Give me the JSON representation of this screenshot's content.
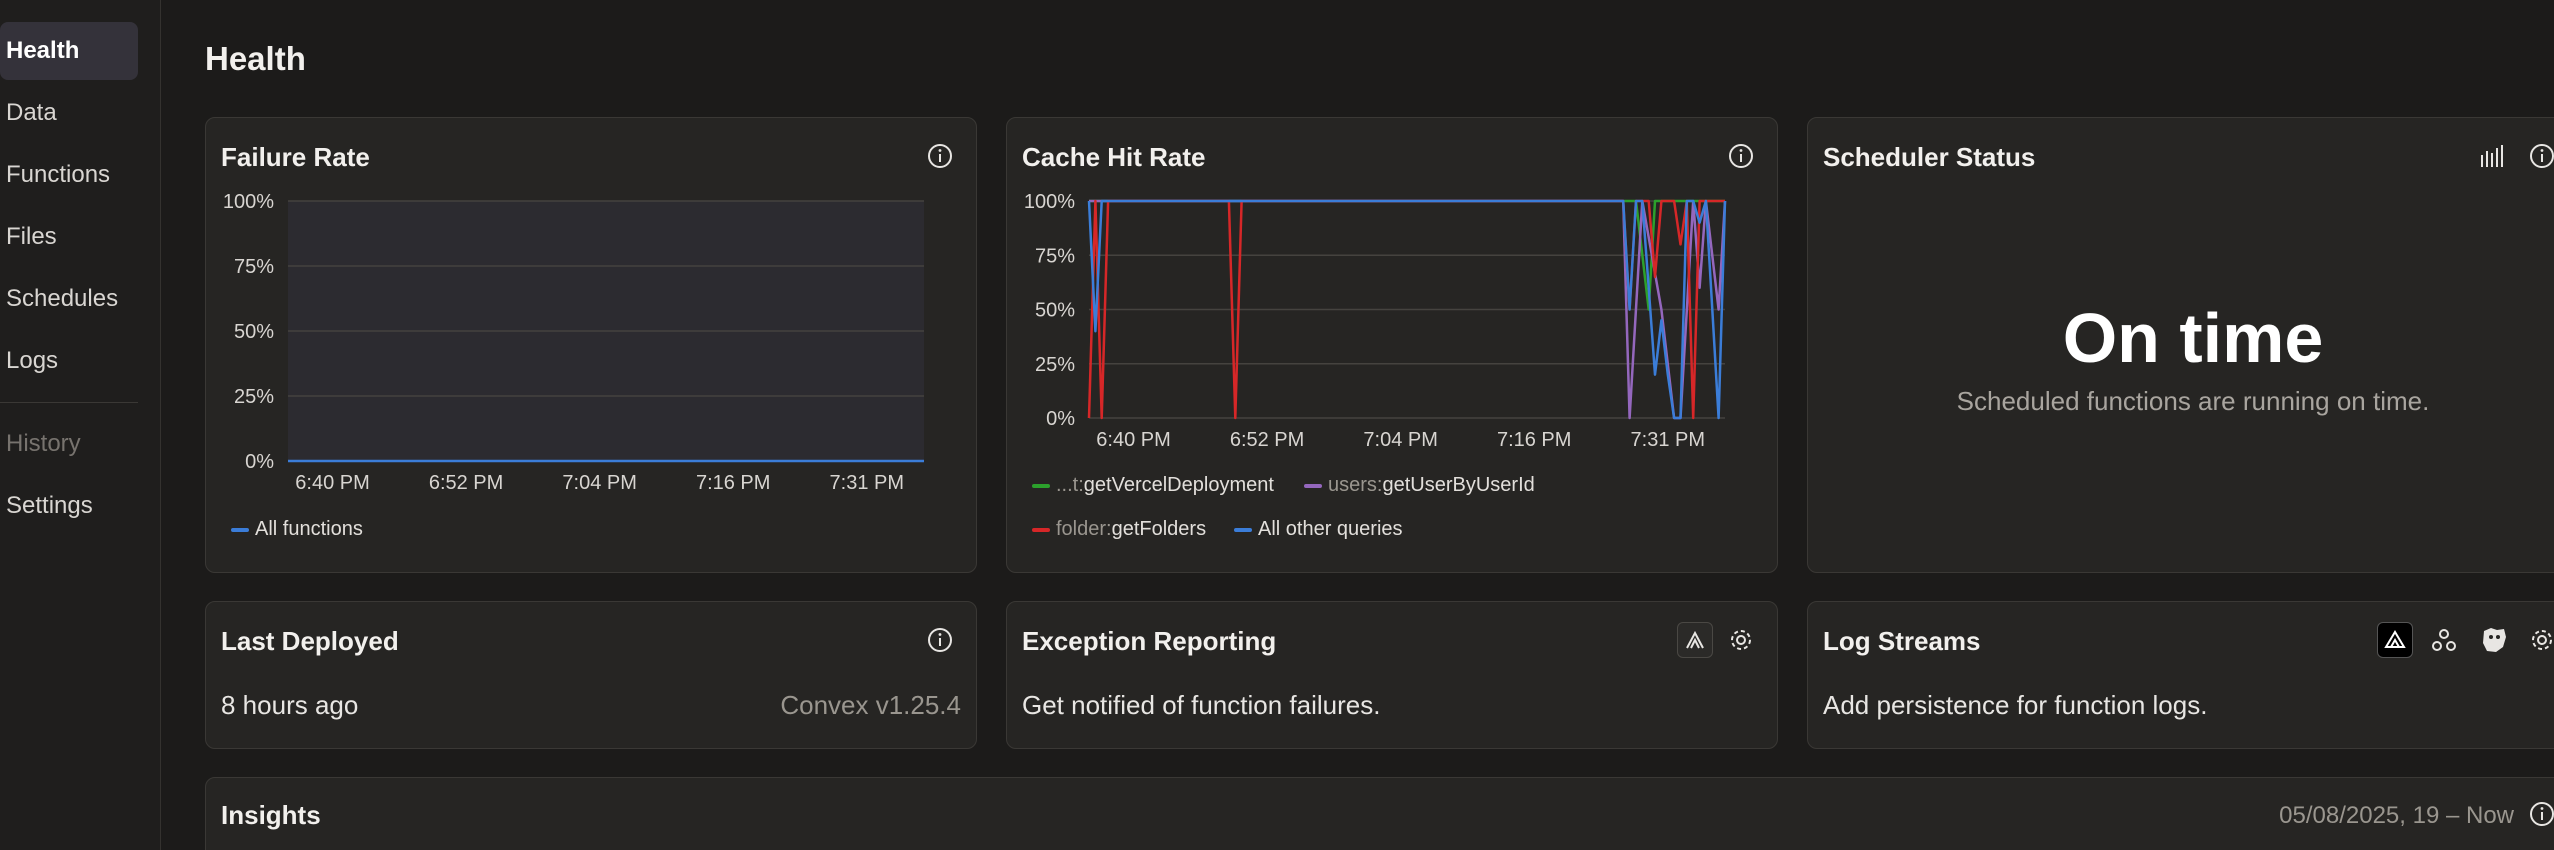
{
  "sidebar": {
    "items": [
      {
        "label": "Health",
        "active": true
      },
      {
        "label": "Data"
      },
      {
        "label": "Functions"
      },
      {
        "label": "Files"
      },
      {
        "label": "Schedules"
      },
      {
        "label": "Logs"
      }
    ],
    "history_label": "History",
    "settings_label": "Settings"
  },
  "page": {
    "title": "Health"
  },
  "failure_rate": {
    "title": "Failure Rate",
    "legend": [
      {
        "name": "All functions",
        "color": "#3b7dd8"
      }
    ]
  },
  "cache_hit_rate": {
    "title": "Cache Hit Rate",
    "legend": [
      {
        "prefix": "...t:",
        "name": "getVercelDeployment",
        "color": "#2ca02c"
      },
      {
        "prefix": "users:",
        "name": "getUserByUserId",
        "color": "#9467bd"
      },
      {
        "prefix": "folder:",
        "name": "getFolders",
        "color": "#d62728"
      },
      {
        "prefix": "",
        "name": "All other queries",
        "color": "#3b7dd8"
      }
    ]
  },
  "scheduler": {
    "title": "Scheduler Status",
    "status": "On time",
    "description": "Scheduled functions are running on time."
  },
  "last_deployed": {
    "title": "Last Deployed",
    "time": "8 hours ago",
    "version": "Convex v1.25.4"
  },
  "exception_reporting": {
    "title": "Exception Reporting",
    "description": "Get notified of function failures."
  },
  "log_streams": {
    "title": "Log Streams",
    "description": "Add persistence for function logs."
  },
  "insights": {
    "title": "Insights",
    "range": "05/08/2025, 19 – Now"
  },
  "chart_data": [
    {
      "type": "line",
      "title": "Failure Rate",
      "x_ticks": [
        "6:40 PM",
        "6:52 PM",
        "7:04 PM",
        "7:16 PM",
        "7:31 PM"
      ],
      "y_ticks": [
        "100%",
        "75%",
        "50%",
        "25%",
        "0%"
      ],
      "ylim": [
        0,
        100
      ],
      "series": [
        {
          "name": "All functions",
          "color": "#3b7dd8",
          "x": [
            0,
            100
          ],
          "y": [
            0,
            0
          ]
        }
      ]
    },
    {
      "type": "line",
      "title": "Cache Hit Rate",
      "x_ticks": [
        "6:40 PM",
        "6:52 PM",
        "7:04 PM",
        "7:16 PM",
        "7:31 PM"
      ],
      "y_ticks": [
        "100%",
        "75%",
        "50%",
        "25%",
        "0%"
      ],
      "ylim": [
        0,
        100
      ],
      "series": [
        {
          "name": "...t:getVercelDeployment",
          "color": "#2ca02c",
          "x": [
            0,
            86,
            88,
            89,
            91,
            93,
            95,
            97,
            100
          ],
          "y": [
            100,
            100,
            50,
            100,
            100,
            100,
            100,
            100,
            100
          ]
        },
        {
          "name": "users:getUserByUserId",
          "color": "#9467bd",
          "x": [
            0,
            84,
            85,
            87,
            90,
            92,
            93,
            95,
            96,
            97,
            99,
            100
          ],
          "y": [
            100,
            100,
            0,
            100,
            50,
            0,
            0,
            100,
            60,
            100,
            50,
            100
          ]
        },
        {
          "name": "folder:getFolders",
          "color": "#d62728",
          "x": [
            0,
            1,
            2,
            3,
            4,
            5,
            22,
            23,
            24,
            25,
            84,
            85,
            86,
            87,
            88,
            89,
            90,
            91,
            92,
            93,
            94,
            95,
            96,
            100
          ],
          "y": [
            0,
            100,
            0,
            100,
            100,
            100,
            100,
            0,
            100,
            100,
            100,
            50,
            100,
            100,
            100,
            65,
            100,
            100,
            100,
            80,
            100,
            0,
            100,
            100
          ]
        },
        {
          "name": "All other queries",
          "color": "#3b7dd8",
          "x": [
            0,
            1,
            2,
            3,
            4,
            84,
            85,
            86,
            87,
            88,
            89,
            90,
            91,
            92,
            93,
            94,
            95,
            96,
            97,
            98,
            99,
            100
          ],
          "y": [
            100,
            40,
            100,
            100,
            100,
            100,
            50,
            100,
            100,
            60,
            20,
            45,
            20,
            0,
            0,
            100,
            100,
            90,
            100,
            50,
            0,
            100
          ]
        }
      ]
    }
  ]
}
